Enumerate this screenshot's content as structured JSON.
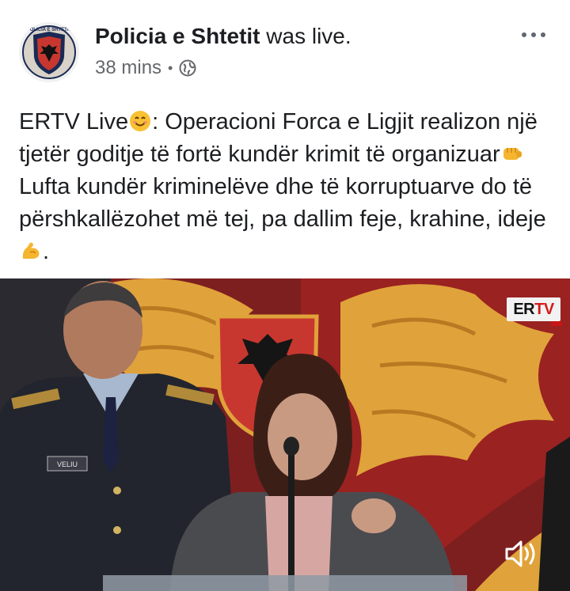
{
  "post": {
    "page_name": "Policia e Shtetit",
    "status": "was live.",
    "time": "38 mins",
    "separator": "•",
    "privacy_icon": "globe-icon",
    "more_icon": "more-dots-icon",
    "text_parts": [
      "ERTV Live",
      ": Operacioni Forca e Ligjit realizon një tjetër goditje të fortë kundër krimit të organizuar",
      "Lufta kundër kriminelëve dhe të korruptuarve do të përshkallëzohet më tej, pa dallim feje, krahine, ideje",
      "."
    ],
    "emojis": [
      "smiling-face-emoji",
      "fist-emoji",
      "flexed-biceps-emoji"
    ]
  },
  "avatar": {
    "badge_text": "POLICIA E SHTETIT"
  },
  "video": {
    "logo_er": "ER",
    "logo_tv": "TV",
    "officer_nametag": "VELIU",
    "sound_icon": "speaker-icon"
  },
  "colors": {
    "accent_gold": "#e0a23a",
    "flag_red": "#c8372f",
    "logo_red": "#d11b1b",
    "meta_gray": "#65676b"
  }
}
